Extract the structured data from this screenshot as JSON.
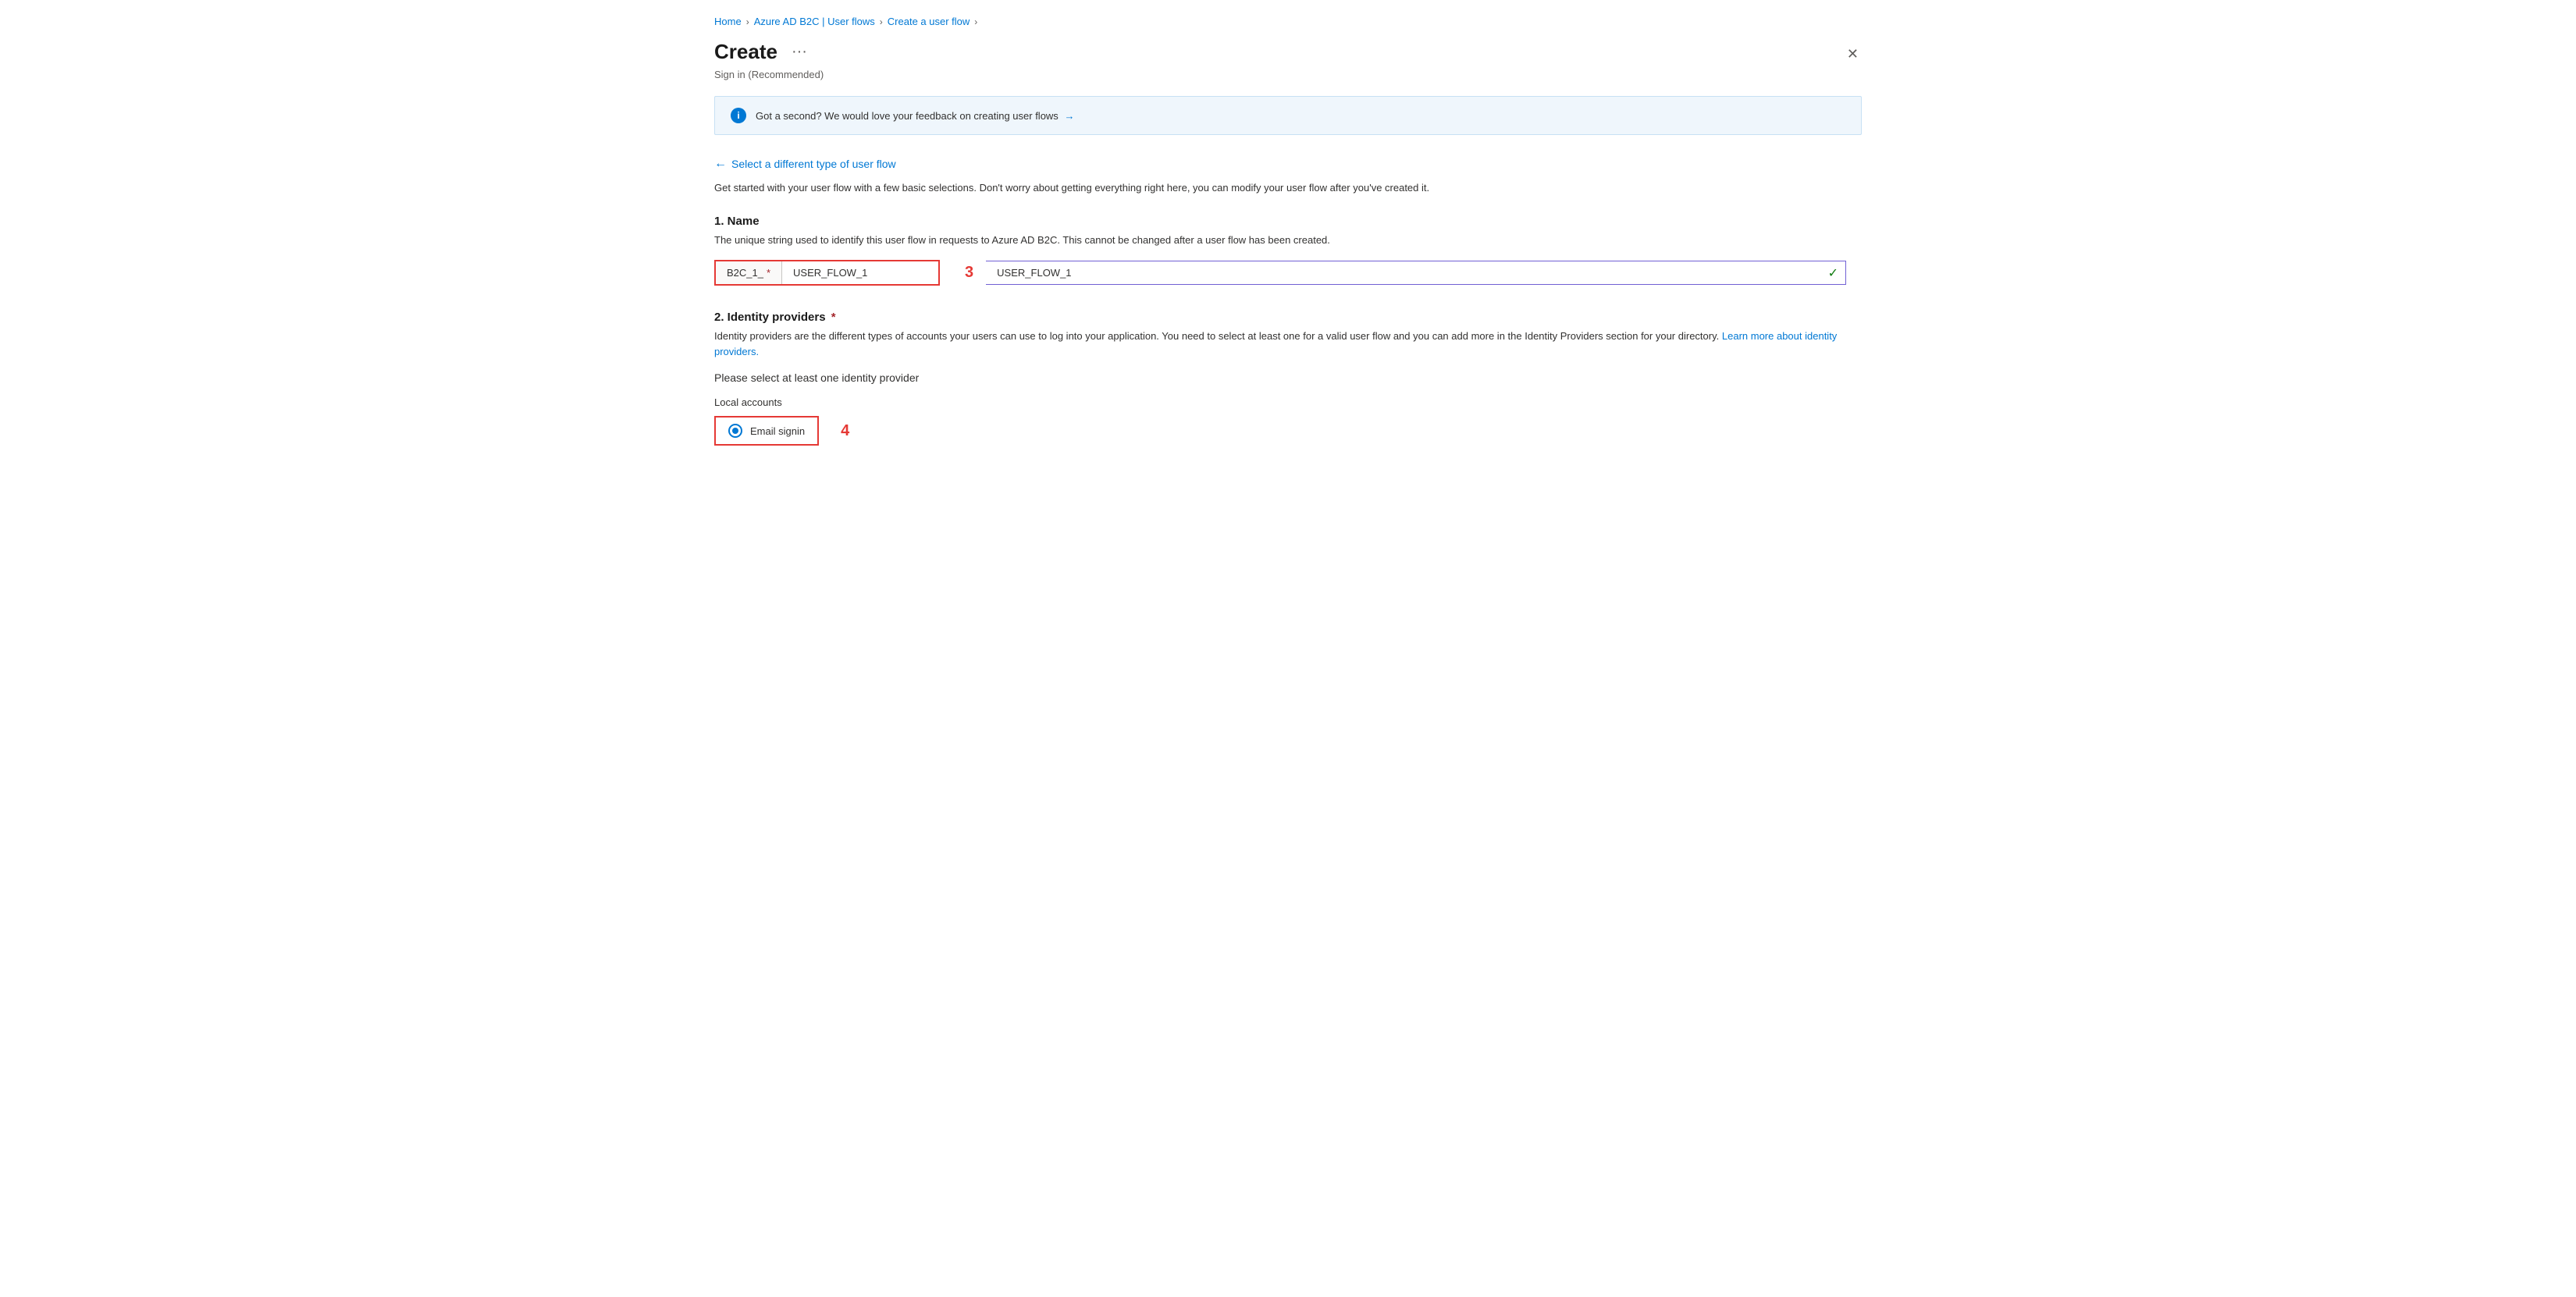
{
  "breadcrumb": {
    "home": "Home",
    "azureADB2C": "Azure AD B2C | User flows",
    "createUserFlow": "Create a user flow",
    "sep": "›"
  },
  "header": {
    "title": "Create",
    "ellipsis": "···",
    "subtitle": "Sign in (Recommended)"
  },
  "close_button": "✕",
  "info_banner": {
    "text": "Got a second? We would love your feedback on creating user flows",
    "arrow": "→"
  },
  "select_link": {
    "arrow": "←",
    "label": "Select a different type of user flow"
  },
  "description": "Get started with your user flow with a few basic selections. Don't worry about getting everything right here, you can modify your user flow after you've created it.",
  "section_name": {
    "heading": "1. Name",
    "desc": "The unique string used to identify this user flow in requests to Azure AD B2C. This cannot be changed after a user flow has been created.",
    "prefix": "B2C_1_",
    "asterisk": "*",
    "input_value": "USER_FLOW_1",
    "annotation": "3",
    "check": "✓"
  },
  "section_identity": {
    "heading": "2. Identity providers",
    "asterisk": "*",
    "desc_part1": "Identity providers are the different types of accounts your users can use to log into your application. You need to select at least one for a valid user flow and you can add more in the Identity Providers section for your directory.",
    "desc_link_text": "Learn more about identity providers.",
    "please_select": "Please select at least one identity provider",
    "local_accounts": "Local accounts",
    "radio_options": [
      {
        "id": "email_signin",
        "label": "Email signin",
        "selected": true
      }
    ],
    "annotation": "4"
  }
}
